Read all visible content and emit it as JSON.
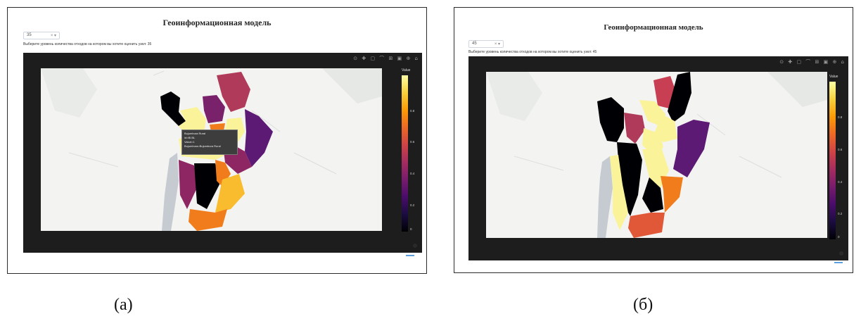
{
  "panel_a": {
    "title": "Геоинформационная модель",
    "dropdown_value": "35",
    "dropdown_controls": "× ▾",
    "instruction": "Выберите уровень количества отходов на котором вы хотите оценить узел: 35",
    "modebar_icons": "⊙ ✚ ▢ ⌒ ⊞ ▣ ⊕ ⌂",
    "colorbar_title": "Value",
    "colorbar_ticks": [
      "0.8",
      "0.6",
      "0.4",
      "0.2",
      "0"
    ],
    "tooltip": {
      "line1": "Bujumbura Rural",
      "line2": "id=BI.BL",
      "line3": "Value=1",
      "line4": "Bujumbura=Bujumbura Rural"
    },
    "caption": "(a)"
  },
  "panel_b": {
    "title": "Геоинформационная модель",
    "dropdown_value": "45",
    "dropdown_controls": "× ▾",
    "instruction": "Выберите уровень количества отходов на котором вы хотите оценить узел: 45",
    "modebar_icons": "⊙ ✚ ▢ ⌒ ⊞ ▣ ⊕ ⌂",
    "colorbar_title": "Value",
    "colorbar_ticks": [
      "0.8",
      "0.6",
      "0.4",
      "0.2",
      "0"
    ],
    "caption": "(б)"
  },
  "colors": {
    "black": "#000004",
    "yellow": "#fbf39a",
    "purple": "#5c1a75",
    "magenta": "#8e2663",
    "red": "#c83e52",
    "orange": "#f07c1b",
    "amber": "#f9bc2f",
    "lake": "#c5cbd1"
  }
}
